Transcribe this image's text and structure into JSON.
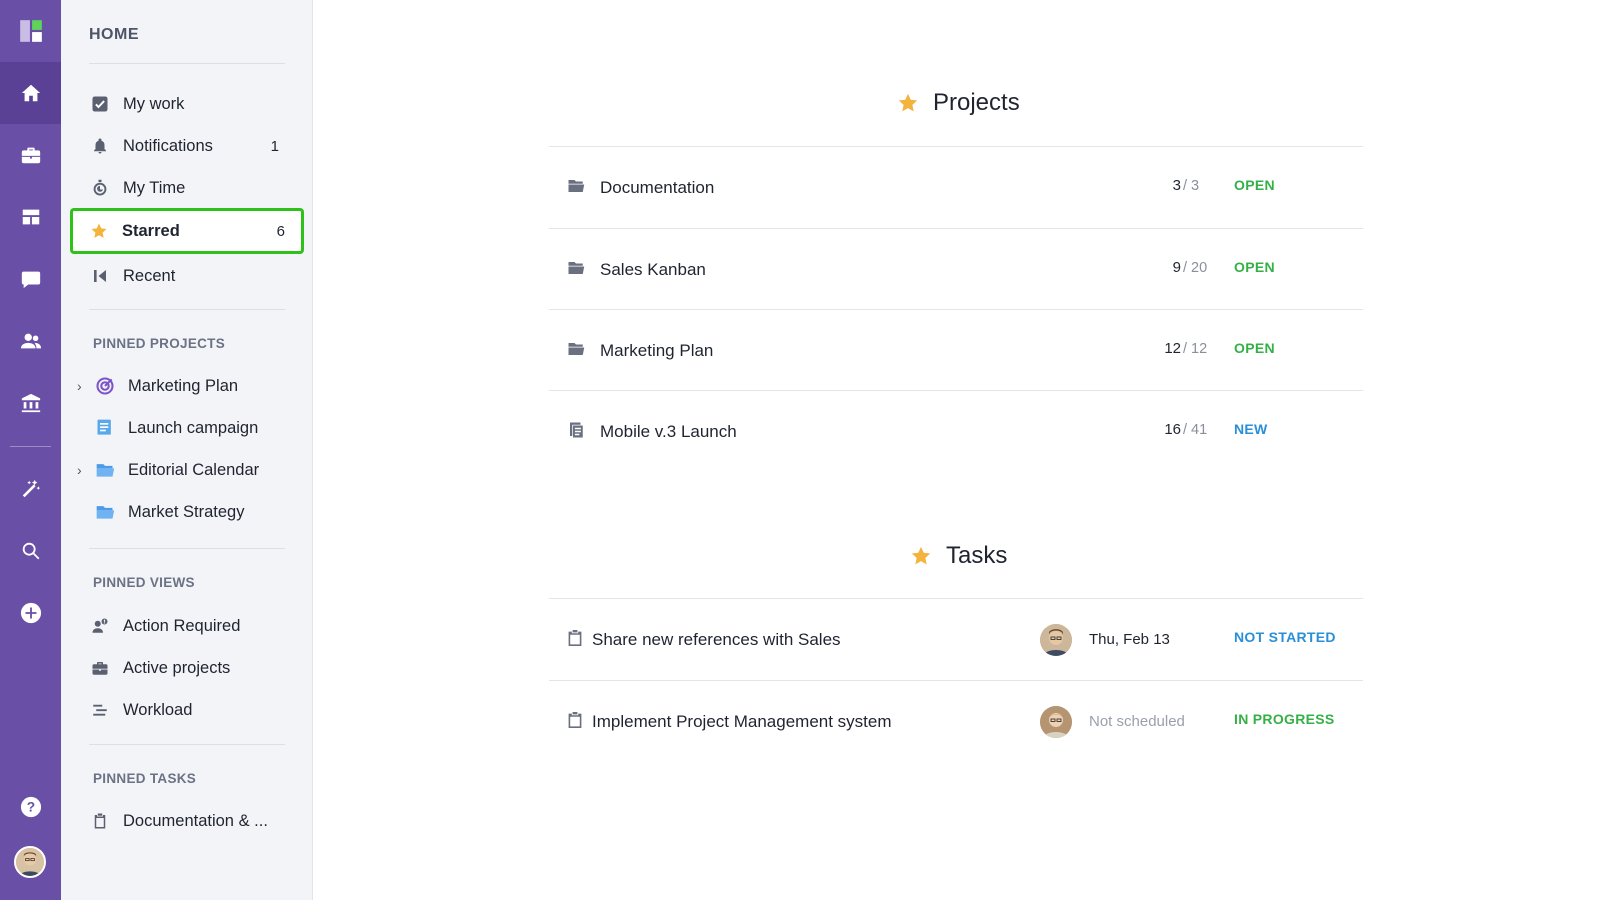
{
  "colors": {
    "rail_bg": "#6a4fa6",
    "sidebar_bg": "#f3f4f8",
    "highlight_border": "#2ec11a",
    "star": "#f3b33d",
    "status_green": "#35b047",
    "status_blue": "#2b8fd8"
  },
  "rail": {
    "items": [
      {
        "icon": "logo-icon"
      },
      {
        "icon": "home-icon"
      },
      {
        "icon": "briefcase-icon"
      },
      {
        "icon": "dashboard-icon"
      },
      {
        "icon": "chat-icon"
      },
      {
        "icon": "people-icon"
      },
      {
        "icon": "bank-icon"
      },
      {
        "icon": "magic-wand-icon"
      },
      {
        "icon": "search-icon"
      },
      {
        "icon": "plus-circle-icon"
      },
      {
        "icon": "help-icon"
      },
      {
        "icon": "avatar"
      }
    ]
  },
  "sidebar": {
    "home_label": "HOME",
    "items": [
      {
        "label": "My work",
        "icon": "checkbox-icon",
        "count": ""
      },
      {
        "label": "Notifications",
        "icon": "bell-icon",
        "count": "1"
      },
      {
        "label": "My Time",
        "icon": "stopwatch-icon",
        "count": ""
      },
      {
        "label": "Starred",
        "icon": "star-icon",
        "count": "6"
      },
      {
        "label": "Recent",
        "icon": "recent-icon",
        "count": ""
      }
    ],
    "pinned_projects_title": "PINNED PROJECTS",
    "pinned_projects": [
      {
        "label": "Marketing Plan",
        "icon": "target-icon",
        "has_children": true
      },
      {
        "label": "Launch campaign",
        "icon": "list-icon",
        "has_children": false
      },
      {
        "label": "Editorial Calendar",
        "icon": "folder-icon",
        "has_children": true
      },
      {
        "label": "Market Strategy",
        "icon": "folder-icon",
        "has_children": false
      }
    ],
    "pinned_views_title": "PINNED VIEWS",
    "pinned_views": [
      {
        "label": "Action Required",
        "icon": "user-alert-icon"
      },
      {
        "label": "Active projects",
        "icon": "briefcase-icon"
      },
      {
        "label": "Workload",
        "icon": "bars-icon"
      }
    ],
    "pinned_tasks_title": "PINNED TASKS",
    "pinned_tasks": [
      {
        "label": "Documentation & ...",
        "icon": "clipboard-icon"
      }
    ]
  },
  "main": {
    "projects_title": "Projects",
    "projects": [
      {
        "name": "Documentation",
        "icon": "folder-icon",
        "done": "3",
        "total": "/ 3",
        "status": "OPEN"
      },
      {
        "name": "Sales Kanban",
        "icon": "folder-icon",
        "done": "9",
        "total": "/ 20",
        "status": "OPEN"
      },
      {
        "name": "Marketing Plan",
        "icon": "folder-icon",
        "done": "12",
        "total": "/ 12",
        "status": "OPEN"
      },
      {
        "name": "Mobile v.3 Launch",
        "icon": "list-icon",
        "done": "16",
        "total": "/ 41",
        "status": "NEW"
      }
    ],
    "tasks_title": "Tasks",
    "tasks": [
      {
        "name": "Share new references with Sales",
        "icon": "clipboard-icon",
        "date": "Thu, Feb 13",
        "status": "NOT STARTED"
      },
      {
        "name": "Implement Project Management system",
        "icon": "clipboard-icon",
        "date": "Not scheduled",
        "status": "IN PROGRESS"
      }
    ]
  }
}
